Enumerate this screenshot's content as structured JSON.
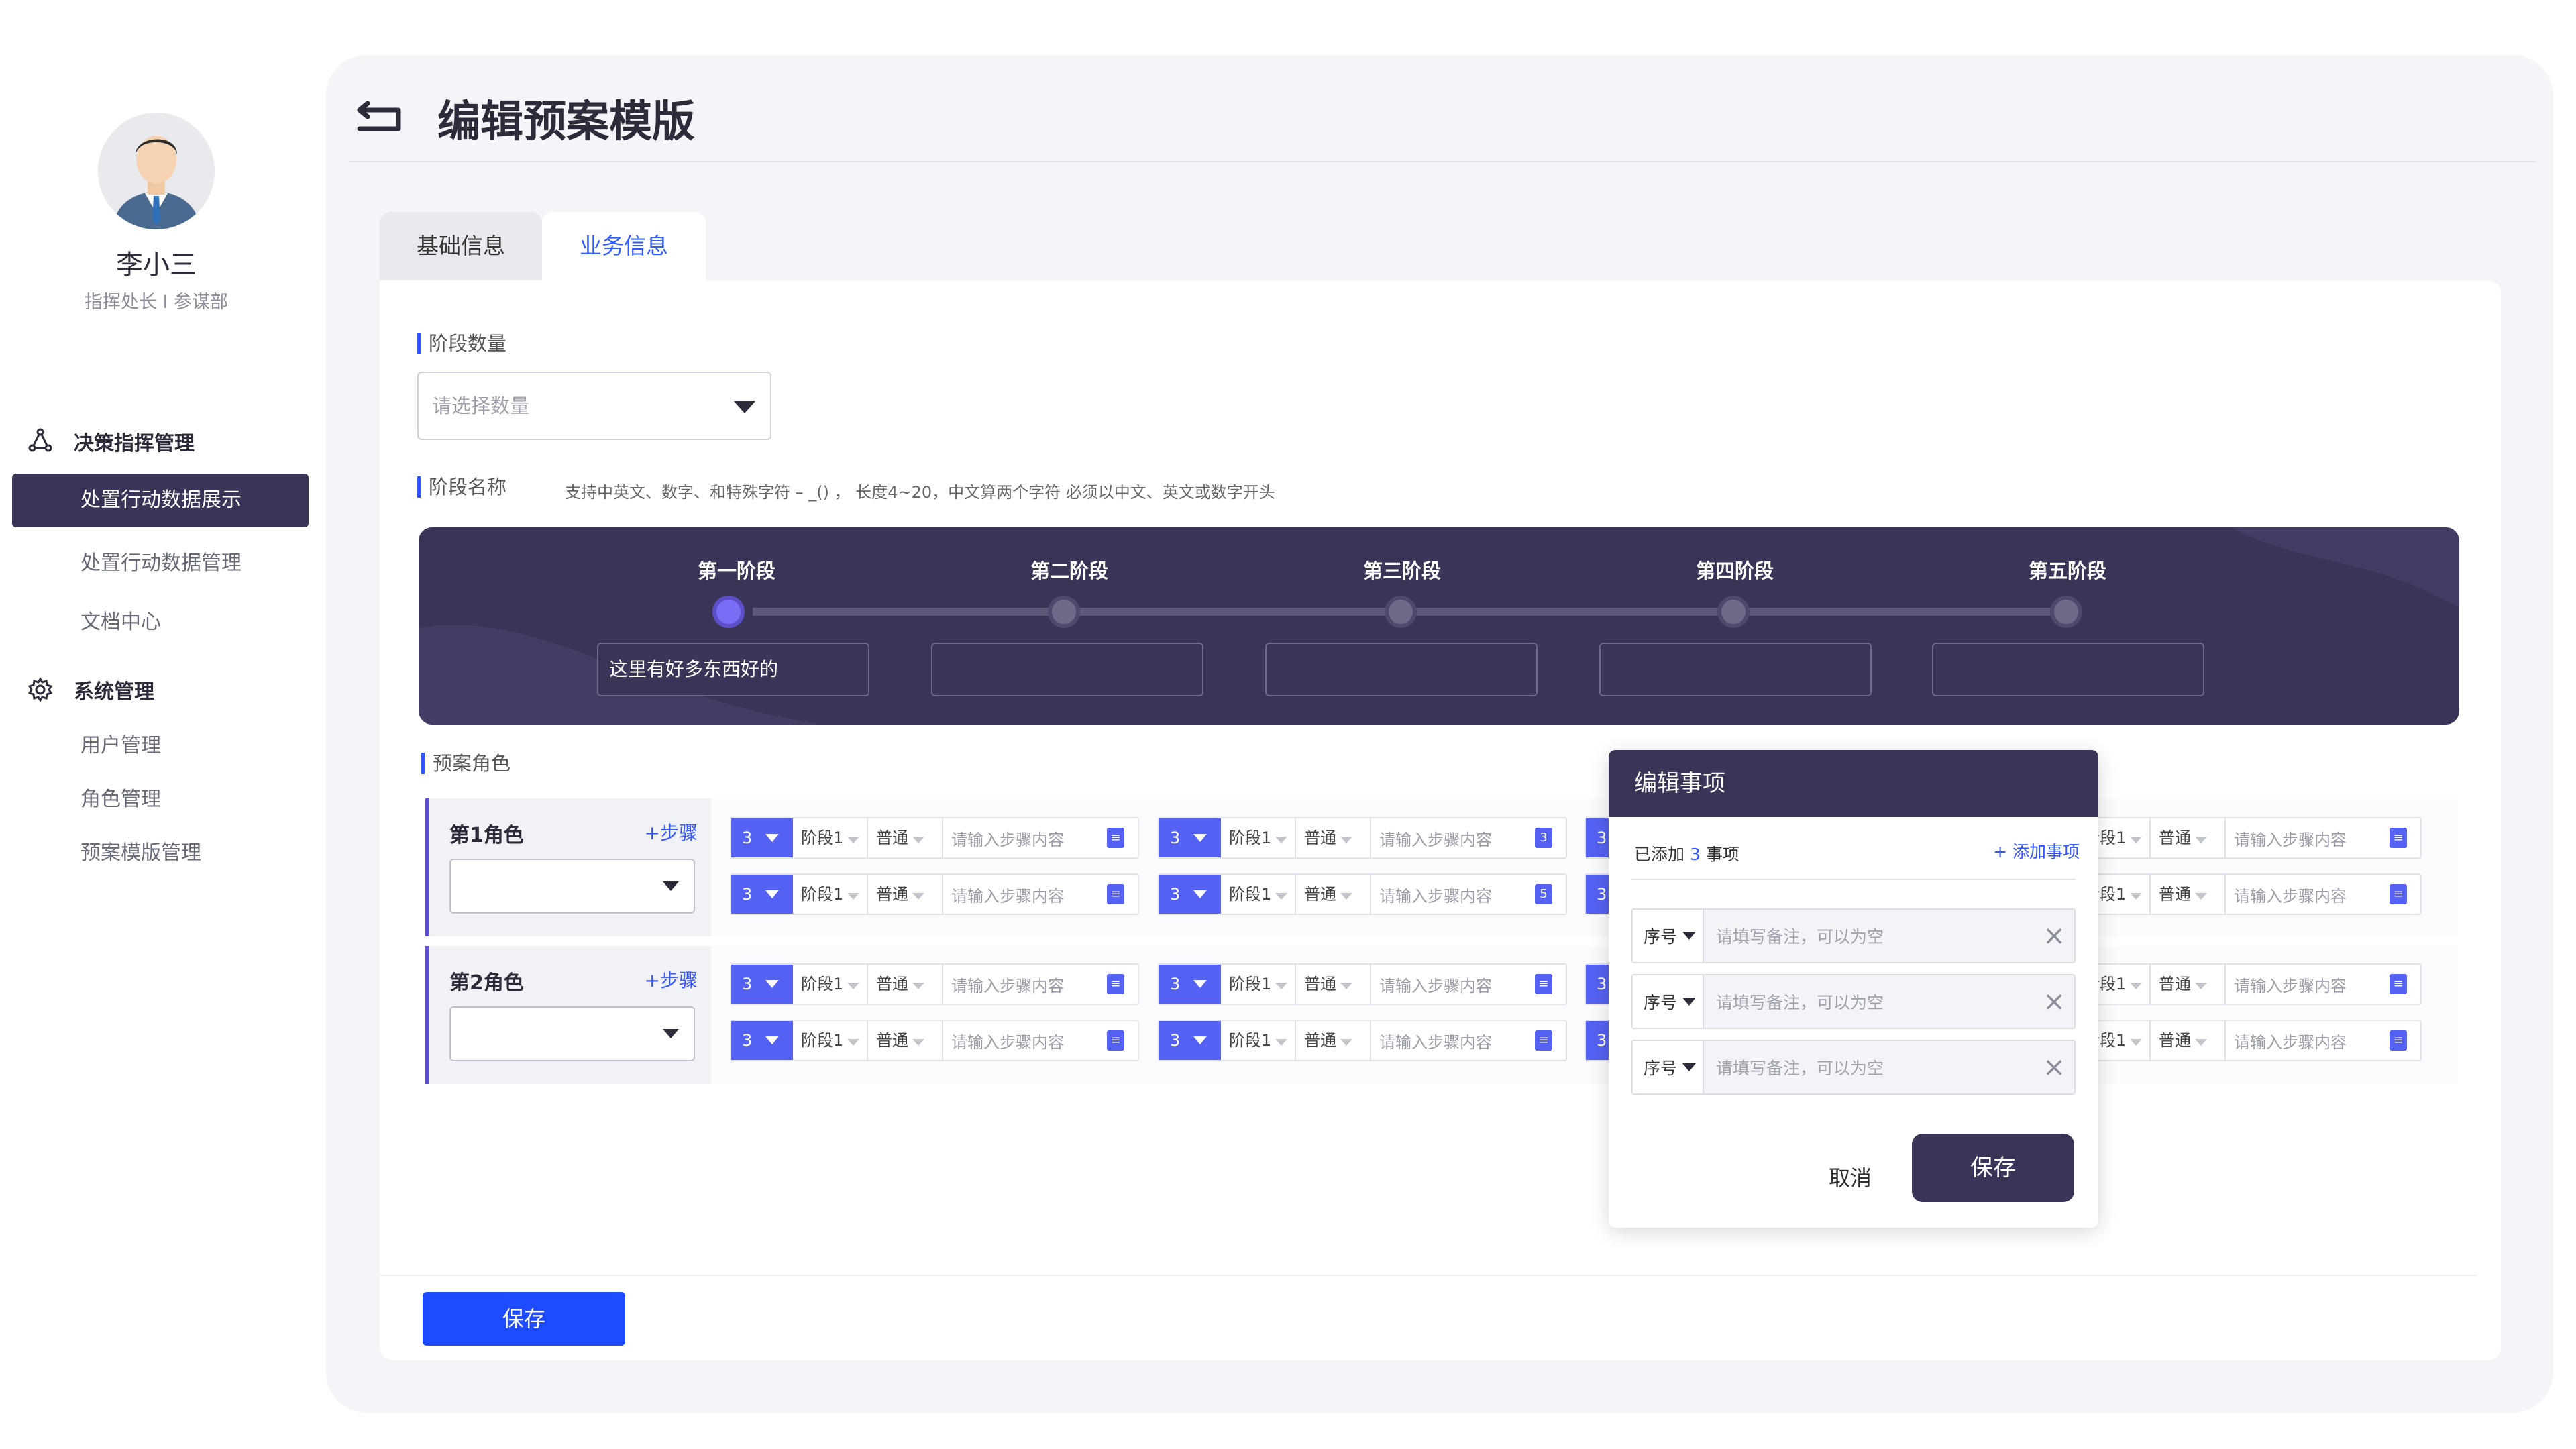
{
  "user": {
    "name": "李小三",
    "role": "指挥处长 I 参谋部"
  },
  "nav": {
    "group1": "决策指挥管理",
    "item_active": "处置行动数据展示",
    "item2": "处置行动数据管理",
    "item3": "文档中心",
    "group2": "系统管理",
    "item4": "用户管理",
    "item5": "角色管理",
    "item6": "预案模版管理"
  },
  "page": {
    "title": "编辑预案模版"
  },
  "tabs": {
    "basic": "基础信息",
    "business": "业务信息"
  },
  "stage_count": {
    "label": "阶段数量",
    "placeholder": "请选择数量"
  },
  "stage_name": {
    "label": "阶段名称",
    "hint": "支持中英文、数字、和特殊字符 – _() ，  长度4~20，中文算两个字符 必须以中文、英文或数字开头"
  },
  "stages": [
    {
      "label": "第一阶段",
      "value": "这里有好多东西好的"
    },
    {
      "label": "第二阶段",
      "value": ""
    },
    {
      "label": "第三阶段",
      "value": ""
    },
    {
      "label": "第四阶段",
      "value": ""
    },
    {
      "label": "第五阶段",
      "value": ""
    }
  ],
  "roles_section": {
    "label": "预案角色",
    "add_step": "+步骤"
  },
  "roles": [
    {
      "name": "第1角色"
    },
    {
      "name": "第2角色"
    }
  ],
  "step": {
    "num": "3",
    "stage": "阶段1",
    "level": "普通",
    "placeholder": "请输入步骤内容"
  },
  "step_badges": {
    "b1": "3",
    "b2": "5"
  },
  "modal": {
    "title": "编辑事项",
    "count_prefix": "已添加",
    "count": "3",
    "count_suffix": "事项",
    "add": "+ 添加事项",
    "seq_label": "序号",
    "note_placeholder": "请填写备注，可以为空",
    "cancel": "取消",
    "save": "保存"
  },
  "footer": {
    "save": "保存"
  }
}
